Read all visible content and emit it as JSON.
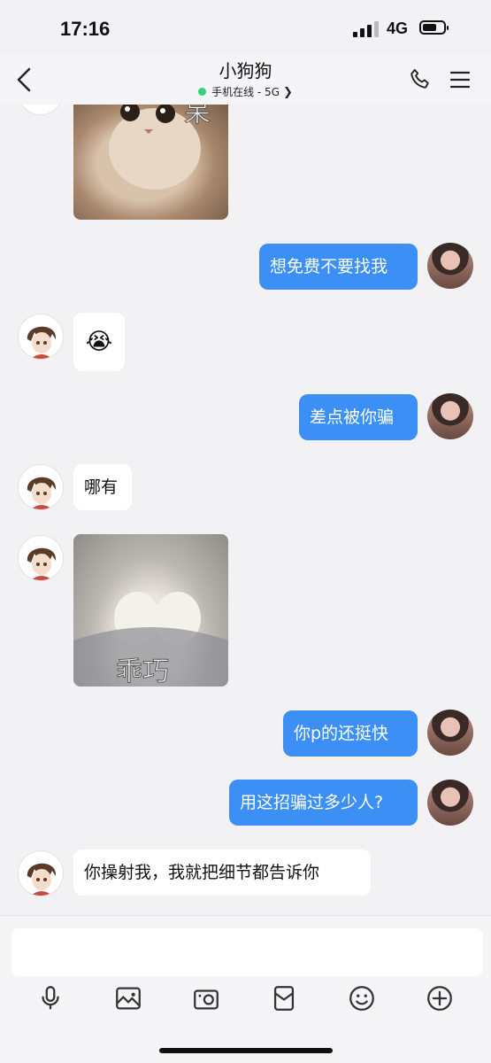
{
  "status": {
    "time": "17:16",
    "network": "4G"
  },
  "header": {
    "title": "小狗狗",
    "subtitle": "手机在线 - 5G"
  },
  "messages": [
    {
      "sender": "them",
      "type": "sticker",
      "caption": "呆",
      "desc": "cat-sticker"
    },
    {
      "sender": "me",
      "type": "text",
      "text": "想免费不要找我"
    },
    {
      "sender": "them",
      "type": "emoji",
      "text": "😭"
    },
    {
      "sender": "me",
      "type": "text",
      "text": "差点被你骗"
    },
    {
      "sender": "them",
      "type": "text",
      "text": "哪有"
    },
    {
      "sender": "them",
      "type": "sticker",
      "caption": "乖巧",
      "desc": "cat-paws-sticker"
    },
    {
      "sender": "me",
      "type": "text",
      "text": "你p的还挺快"
    },
    {
      "sender": "me",
      "type": "text",
      "text": "用这招骗过多少人?"
    },
    {
      "sender": "them",
      "type": "text",
      "text": "你操射我，我就把细节都告诉你"
    }
  ],
  "composer": {
    "input_value": "",
    "tools": [
      "microphone-icon",
      "photo-icon",
      "camera-icon",
      "red-packet-icon",
      "emoji-icon",
      "plus-icon"
    ]
  },
  "colors": {
    "outgoing_bubble": "#3b8ff5",
    "incoming_bubble": "#ffffff",
    "online_dot": "#33d17a",
    "background": "#f2f2f4"
  }
}
